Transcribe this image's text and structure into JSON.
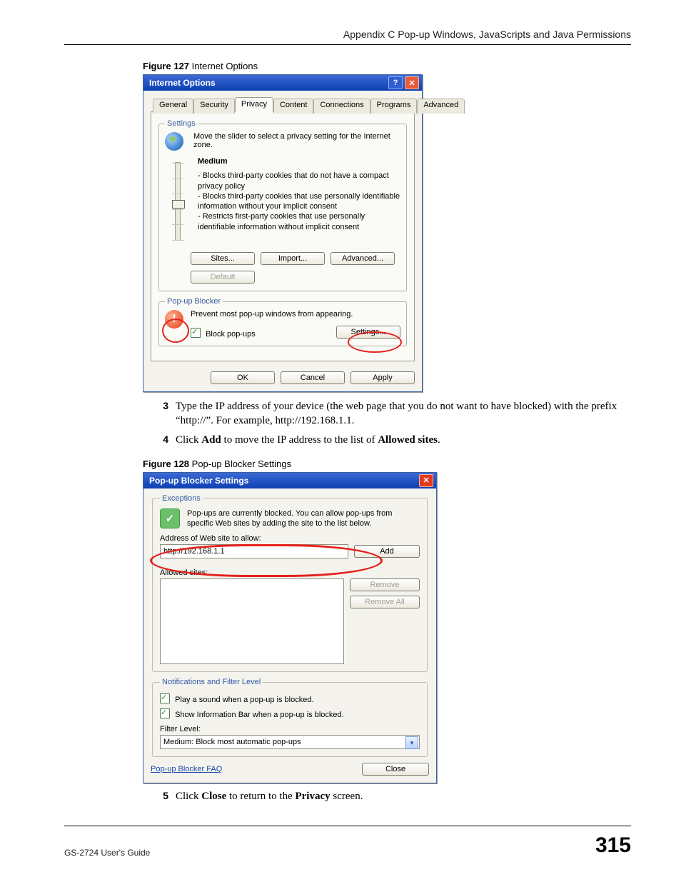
{
  "page": {
    "running_head": "Appendix C Pop-up Windows, JavaScripts and Java Permissions",
    "footer_left": "GS-2724 User's Guide",
    "footer_right": "315"
  },
  "fig127": {
    "caption_bold": "Figure 127",
    "caption_rest": "   Internet Options",
    "title": "Internet Options",
    "tabs": [
      "General",
      "Security",
      "Privacy",
      "Content",
      "Connections",
      "Programs",
      "Advanced"
    ],
    "settings_legend": "Settings",
    "settings_intro": "Move the slider to select a privacy setting for the Internet zone.",
    "slider_level": "Medium",
    "slider_details": "- Blocks third-party cookies that do not have a compact privacy policy\n- Blocks third-party cookies that use personally identifiable information without your implicit consent\n- Restricts first-party cookies that use personally identifiable information without implicit consent",
    "buttons": {
      "sites": "Sites...",
      "import": "Import...",
      "advanced": "Advanced...",
      "default": "Default"
    },
    "popup_legend": "Pop-up Blocker",
    "popup_intro": "Prevent most pop-up windows from appearing.",
    "block_popups_label": "Block pop-ups",
    "popup_settings_btn": "Settings...",
    "dialog_ok": "OK",
    "dialog_cancel": "Cancel",
    "dialog_apply": "Apply"
  },
  "instructions": {
    "s3_num": "3",
    "s3_text_a": "Type the IP address of your device (the web page that you do not want to have blocked) with the prefix “http://”. For example, http://192.168.1.1.",
    "s4_num": "4",
    "s4_text_pre": "Click ",
    "s4_bold1": "Add",
    "s4_text_mid": " to move the IP address to the list of ",
    "s4_bold2": "Allowed sites",
    "s4_text_post": ".",
    "s5_num": "5",
    "s5_text_pre": "Click ",
    "s5_bold1": "Close",
    "s5_text_mid": " to return to the ",
    "s5_bold2": "Privacy",
    "s5_text_post": " screen."
  },
  "fig128": {
    "caption_bold": "Figure 128",
    "caption_rest": "   Pop-up Blocker Settings",
    "title": "Pop-up Blocker Settings",
    "exceptions_legend": "Exceptions",
    "exceptions_intro": "Pop-ups are currently blocked. You can allow pop-ups from specific Web sites by adding the site to the list below.",
    "address_label": "Address of Web site to allow:",
    "address_value": "http://192.168.1.1",
    "add_btn": "Add",
    "allowed_label": "Allowed sites:",
    "remove_btn": "Remove",
    "removeall_btn": "Remove All",
    "notif_legend": "Notifications and Filter Level",
    "play_sound_label": "Play a sound when a pop-up is blocked.",
    "show_bar_label": "Show Information Bar when a pop-up is blocked.",
    "filter_level_label": "Filter Level:",
    "filter_level_value": "Medium: Block most automatic pop-ups",
    "faq_link": "Pop-up Blocker FAQ",
    "close_btn": "Close"
  }
}
